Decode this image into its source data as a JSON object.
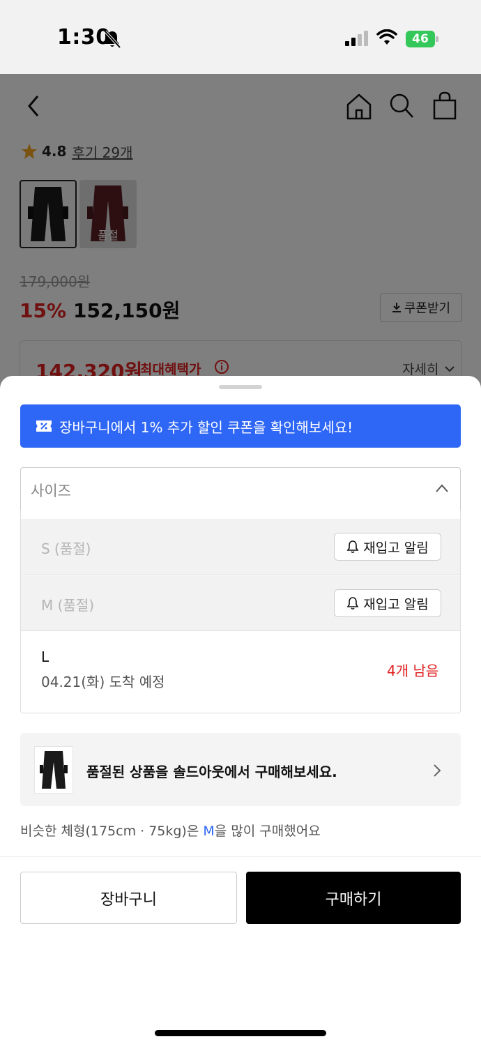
{
  "status_bar": {
    "time": "1:30",
    "battery": "46"
  },
  "product": {
    "rating": "4.8",
    "review_link": "후기 29개",
    "soldout_thumb_label": "품절",
    "original_price": "179,000원",
    "discount": "15%",
    "price": "152,150원",
    "coupon_button": "쿠폰받기",
    "max_benefit_price": "142,320원",
    "max_benefit_label": "최대혜택가",
    "detail_link": "자세히"
  },
  "sheet": {
    "banner_text": "장바구니에서 1% 추가 할인 쿠폰을 확인해보세요!",
    "size_select_label": "사이즈",
    "options": [
      {
        "name": "S (품절)",
        "action": "재입고 알림"
      },
      {
        "name": "M (품절)",
        "action": "재입고 알림"
      },
      {
        "name": "L",
        "delivery": "04.21(화) 도착 예정",
        "stock": "4개 남음"
      }
    ],
    "soldout_promo": "품절된 상품을 솔드아웃에서 구매해보세요.",
    "similar": {
      "prefix": "비슷한 체형(175cm · 75kg)은 ",
      "size": "M",
      "suffix": "을 많이 구매했어요"
    },
    "cart_button": "장바구니",
    "buy_button": "구매하기"
  },
  "colors": {
    "accent_red": "#e02020",
    "banner_blue": "#2e66f5",
    "battery_green": "#34c759"
  }
}
